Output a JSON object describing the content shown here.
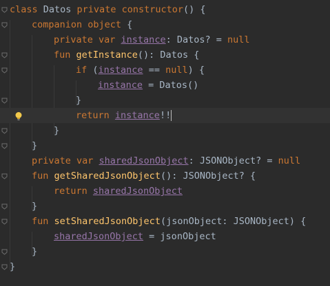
{
  "editor": {
    "lines": [
      {
        "indent": 0,
        "tokens": [
          {
            "t": "kw",
            "v": "class "
          },
          {
            "t": "cls",
            "v": "Datos"
          },
          {
            "t": "kw",
            "v": " private constructor"
          },
          {
            "t": "plain",
            "v": "() {"
          }
        ]
      },
      {
        "indent": 1,
        "tokens": [
          {
            "t": "kw",
            "v": "companion object "
          },
          {
            "t": "plain",
            "v": "{"
          }
        ]
      },
      {
        "indent": 2,
        "tokens": [
          {
            "t": "kw",
            "v": "private var "
          },
          {
            "t": "prop",
            "v": "instance"
          },
          {
            "t": "plain",
            "v": ": Datos? = "
          },
          {
            "t": "kw",
            "v": "null"
          }
        ]
      },
      {
        "indent": 2,
        "tokens": [
          {
            "t": "kw",
            "v": "fun "
          },
          {
            "t": "fn",
            "v": "getInstance"
          },
          {
            "t": "plain",
            "v": "(): Datos {"
          }
        ]
      },
      {
        "indent": 3,
        "tokens": [
          {
            "t": "kw",
            "v": "if "
          },
          {
            "t": "plain",
            "v": "("
          },
          {
            "t": "prop",
            "v": "instance"
          },
          {
            "t": "plain",
            "v": " == "
          },
          {
            "t": "kw",
            "v": "null"
          },
          {
            "t": "plain",
            "v": ") {"
          }
        ]
      },
      {
        "indent": 4,
        "tokens": [
          {
            "t": "prop",
            "v": "instance"
          },
          {
            "t": "plain",
            "v": " = Datos()"
          }
        ]
      },
      {
        "indent": 3,
        "tokens": [
          {
            "t": "plain",
            "v": "}"
          }
        ]
      },
      {
        "indent": 3,
        "tokens": [
          {
            "t": "kw",
            "v": "return "
          },
          {
            "t": "prop",
            "v": "instance"
          },
          {
            "t": "plain",
            "v": "!!"
          }
        ],
        "current": true
      },
      {
        "indent": 2,
        "tokens": [
          {
            "t": "plain",
            "v": "}"
          }
        ]
      },
      {
        "indent": 1,
        "tokens": [
          {
            "t": "plain",
            "v": "}"
          }
        ]
      },
      {
        "indent": 1,
        "tokens": [
          {
            "t": "kw",
            "v": "private var "
          },
          {
            "t": "prop",
            "v": "sharedJsonObject"
          },
          {
            "t": "plain",
            "v": ": JSONObject? = "
          },
          {
            "t": "kw",
            "v": "null"
          }
        ]
      },
      {
        "indent": 1,
        "tokens": [
          {
            "t": "kw",
            "v": "fun "
          },
          {
            "t": "fn",
            "v": "getSharedJsonObject"
          },
          {
            "t": "plain",
            "v": "(): JSONObject? {"
          }
        ]
      },
      {
        "indent": 2,
        "tokens": [
          {
            "t": "kw",
            "v": "return "
          },
          {
            "t": "prop",
            "v": "sharedJsonObject"
          }
        ]
      },
      {
        "indent": 1,
        "tokens": [
          {
            "t": "plain",
            "v": "}"
          }
        ]
      },
      {
        "indent": 1,
        "tokens": [
          {
            "t": "kw",
            "v": "fun "
          },
          {
            "t": "fn",
            "v": "setSharedJsonObject"
          },
          {
            "t": "plain",
            "v": "(jsonObject: JSONObject) {"
          }
        ]
      },
      {
        "indent": 2,
        "tokens": [
          {
            "t": "prop",
            "v": "sharedJsonObject"
          },
          {
            "t": "plain",
            "v": " = jsonObject"
          }
        ]
      },
      {
        "indent": 1,
        "tokens": [
          {
            "t": "plain",
            "v": "}"
          }
        ]
      },
      {
        "indent": 0,
        "tokens": [
          {
            "t": "plain",
            "v": "}"
          }
        ]
      }
    ],
    "bulb_icon": "lightbulb-icon",
    "fold_icon": "fold-marker-icon",
    "colors": {
      "background": "#2b2b2b",
      "keyword": "#cc7832",
      "function": "#ffc66d",
      "property": "#9876aa",
      "text": "#a9b7c6",
      "current_line": "#323232"
    }
  }
}
